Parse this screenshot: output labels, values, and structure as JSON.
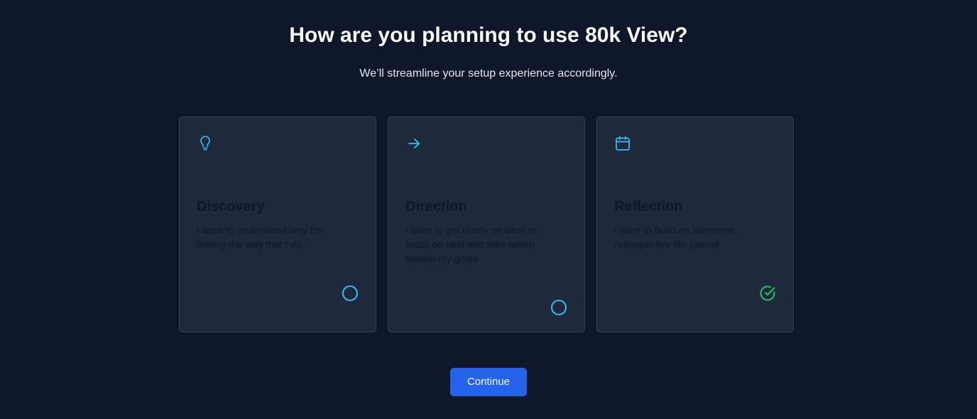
{
  "header": {
    "title": "How are you planning to use 80k View?",
    "subtitle": "We’ll streamline your setup experience accordingly."
  },
  "options": [
    {
      "icon": "lightbulb-icon",
      "title": "Discovery",
      "description": "I want to understand why I’m feeling the way that I do.",
      "selected": false
    },
    {
      "icon": "arrow-right-icon",
      "title": "Direction",
      "description": "I want to get clarity on what to focus on next and take action toward my goals",
      "selected": false
    },
    {
      "icon": "calendar-icon",
      "title": "Reflection",
      "description": "I want to build an awesome, retrospective life journal.",
      "selected": true
    }
  ],
  "footer": {
    "continue_label": "Continue"
  },
  "colors": {
    "background": "#0f172a",
    "card": "#1e293b",
    "accent": "#38bdf8",
    "selected": "#22c55e",
    "button": "#2563eb"
  }
}
